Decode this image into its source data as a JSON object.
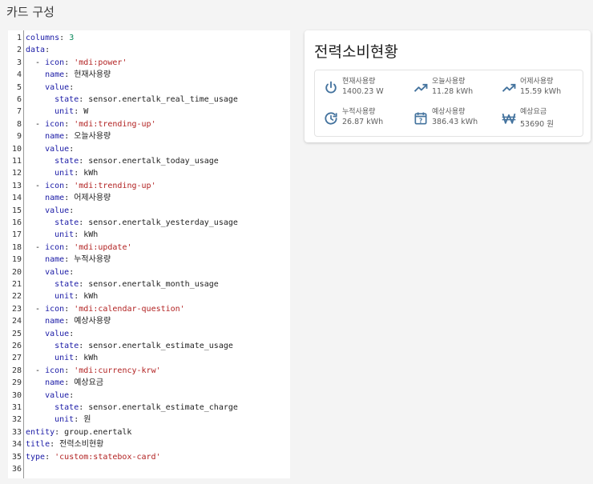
{
  "page": {
    "title": "카드 구성"
  },
  "editor": {
    "lines": [
      [
        {
          "t": "columns",
          "c": "key"
        },
        {
          "t": ": ",
          "c": "val"
        },
        {
          "t": "3",
          "c": "num"
        }
      ],
      [
        {
          "t": "data",
          "c": "key"
        },
        {
          "t": ":",
          "c": "val"
        }
      ],
      [
        {
          "t": "  - ",
          "c": "val"
        },
        {
          "t": "icon",
          "c": "key"
        },
        {
          "t": ": ",
          "c": "val"
        },
        {
          "t": "'mdi:power'",
          "c": "str"
        }
      ],
      [
        {
          "t": "    ",
          "c": "val"
        },
        {
          "t": "name",
          "c": "key"
        },
        {
          "t": ": 현재사용량",
          "c": "val"
        }
      ],
      [
        {
          "t": "    ",
          "c": "val"
        },
        {
          "t": "value",
          "c": "key"
        },
        {
          "t": ":",
          "c": "val"
        }
      ],
      [
        {
          "t": "      ",
          "c": "val"
        },
        {
          "t": "state",
          "c": "key"
        },
        {
          "t": ": sensor.enertalk_real_time_usage",
          "c": "val"
        }
      ],
      [
        {
          "t": "      ",
          "c": "val"
        },
        {
          "t": "unit",
          "c": "key"
        },
        {
          "t": ": W",
          "c": "val"
        }
      ],
      [
        {
          "t": "  - ",
          "c": "val"
        },
        {
          "t": "icon",
          "c": "key"
        },
        {
          "t": ": ",
          "c": "val"
        },
        {
          "t": "'mdi:trending-up'",
          "c": "str"
        }
      ],
      [
        {
          "t": "    ",
          "c": "val"
        },
        {
          "t": "name",
          "c": "key"
        },
        {
          "t": ": 오늘사용량",
          "c": "val"
        }
      ],
      [
        {
          "t": "    ",
          "c": "val"
        },
        {
          "t": "value",
          "c": "key"
        },
        {
          "t": ":",
          "c": "val"
        }
      ],
      [
        {
          "t": "      ",
          "c": "val"
        },
        {
          "t": "state",
          "c": "key"
        },
        {
          "t": ": sensor.enertalk_today_usage",
          "c": "val"
        }
      ],
      [
        {
          "t": "      ",
          "c": "val"
        },
        {
          "t": "unit",
          "c": "key"
        },
        {
          "t": ": kWh",
          "c": "val"
        }
      ],
      [
        {
          "t": "  - ",
          "c": "val"
        },
        {
          "t": "icon",
          "c": "key"
        },
        {
          "t": ": ",
          "c": "val"
        },
        {
          "t": "'mdi:trending-up'",
          "c": "str"
        }
      ],
      [
        {
          "t": "    ",
          "c": "val"
        },
        {
          "t": "name",
          "c": "key"
        },
        {
          "t": ": 어제사용량",
          "c": "val"
        }
      ],
      [
        {
          "t": "    ",
          "c": "val"
        },
        {
          "t": "value",
          "c": "key"
        },
        {
          "t": ":",
          "c": "val"
        }
      ],
      [
        {
          "t": "      ",
          "c": "val"
        },
        {
          "t": "state",
          "c": "key"
        },
        {
          "t": ": sensor.enertalk_yesterday_usage",
          "c": "val"
        }
      ],
      [
        {
          "t": "      ",
          "c": "val"
        },
        {
          "t": "unit",
          "c": "key"
        },
        {
          "t": ": kWh",
          "c": "val"
        }
      ],
      [
        {
          "t": "  - ",
          "c": "val"
        },
        {
          "t": "icon",
          "c": "key"
        },
        {
          "t": ": ",
          "c": "val"
        },
        {
          "t": "'mdi:update'",
          "c": "str"
        }
      ],
      [
        {
          "t": "    ",
          "c": "val"
        },
        {
          "t": "name",
          "c": "key"
        },
        {
          "t": ": 누적사용량",
          "c": "val"
        }
      ],
      [
        {
          "t": "    ",
          "c": "val"
        },
        {
          "t": "value",
          "c": "key"
        },
        {
          "t": ":",
          "c": "val"
        }
      ],
      [
        {
          "t": "      ",
          "c": "val"
        },
        {
          "t": "state",
          "c": "key"
        },
        {
          "t": ": sensor.enertalk_month_usage",
          "c": "val"
        }
      ],
      [
        {
          "t": "      ",
          "c": "val"
        },
        {
          "t": "unit",
          "c": "key"
        },
        {
          "t": ": kWh",
          "c": "val"
        }
      ],
      [
        {
          "t": "  - ",
          "c": "val"
        },
        {
          "t": "icon",
          "c": "key"
        },
        {
          "t": ": ",
          "c": "val"
        },
        {
          "t": "'mdi:calendar-question'",
          "c": "str"
        }
      ],
      [
        {
          "t": "    ",
          "c": "val"
        },
        {
          "t": "name",
          "c": "key"
        },
        {
          "t": ": 예상사용량",
          "c": "val"
        }
      ],
      [
        {
          "t": "    ",
          "c": "val"
        },
        {
          "t": "value",
          "c": "key"
        },
        {
          "t": ":",
          "c": "val"
        }
      ],
      [
        {
          "t": "      ",
          "c": "val"
        },
        {
          "t": "state",
          "c": "key"
        },
        {
          "t": ": sensor.enertalk_estimate_usage",
          "c": "val"
        }
      ],
      [
        {
          "t": "      ",
          "c": "val"
        },
        {
          "t": "unit",
          "c": "key"
        },
        {
          "t": ": kWh",
          "c": "val"
        }
      ],
      [
        {
          "t": "  - ",
          "c": "val"
        },
        {
          "t": "icon",
          "c": "key"
        },
        {
          "t": ": ",
          "c": "val"
        },
        {
          "t": "'mdi:currency-krw'",
          "c": "str"
        }
      ],
      [
        {
          "t": "    ",
          "c": "val"
        },
        {
          "t": "name",
          "c": "key"
        },
        {
          "t": ": 예상요금",
          "c": "val"
        }
      ],
      [
        {
          "t": "    ",
          "c": "val"
        },
        {
          "t": "value",
          "c": "key"
        },
        {
          "t": ":",
          "c": "val"
        }
      ],
      [
        {
          "t": "      ",
          "c": "val"
        },
        {
          "t": "state",
          "c": "key"
        },
        {
          "t": ": sensor.enertalk_estimate_charge",
          "c": "val"
        }
      ],
      [
        {
          "t": "      ",
          "c": "val"
        },
        {
          "t": "unit",
          "c": "key"
        },
        {
          "t": ": 원",
          "c": "val"
        }
      ],
      [
        {
          "t": "entity",
          "c": "key"
        },
        {
          "t": ": group.enertalk",
          "c": "val"
        }
      ],
      [
        {
          "t": "title",
          "c": "key"
        },
        {
          "t": ": 전력소비현황",
          "c": "val"
        }
      ],
      [
        {
          "t": "type",
          "c": "key"
        },
        {
          "t": ": ",
          "c": "val"
        },
        {
          "t": "'custom:statebox-card'",
          "c": "str"
        }
      ],
      []
    ]
  },
  "card": {
    "title": "전력소비현황",
    "icon_color": "#44739e",
    "items": [
      {
        "icon": "power-icon",
        "name": "현재사용량",
        "value": "1400.23 W"
      },
      {
        "icon": "trending-up-icon",
        "name": "오늘사용량",
        "value": "11.28 kWh"
      },
      {
        "icon": "trending-up-icon",
        "name": "어제사용량",
        "value": "15.59 kWh"
      },
      {
        "icon": "update-icon",
        "name": "누적사용량",
        "value": "26.87 kWh"
      },
      {
        "icon": "calendar-question-icon",
        "name": "예상사용량",
        "value": "386.43 kWh"
      },
      {
        "icon": "currency-krw-icon",
        "name": "예상요금",
        "value": "53690 원"
      }
    ]
  }
}
